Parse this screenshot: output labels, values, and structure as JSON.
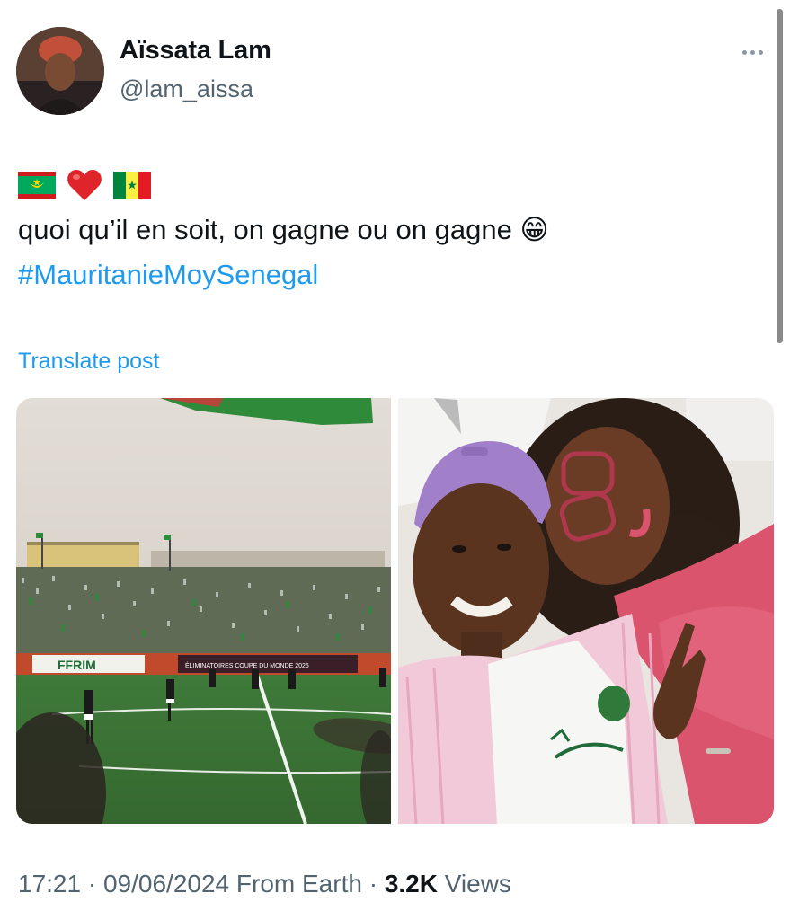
{
  "author": {
    "name": "Aïssata Lam",
    "handle": "@lam_aissa"
  },
  "post": {
    "text_line": "quoi qu’il en soit, on gagne ou on gagne 😁",
    "hashtag": "#MauritanieMoySenegal",
    "translate_label": "Translate post"
  },
  "photos": {
    "banner_left": "FFRIM",
    "banner_center": "ÉLIMINATOIRES COUPE DU MONDE 2026"
  },
  "footer": {
    "time": "17:21",
    "date": "09/06/2024",
    "source": "From Earth",
    "views_count": "3.2K",
    "views_label": "Views"
  }
}
